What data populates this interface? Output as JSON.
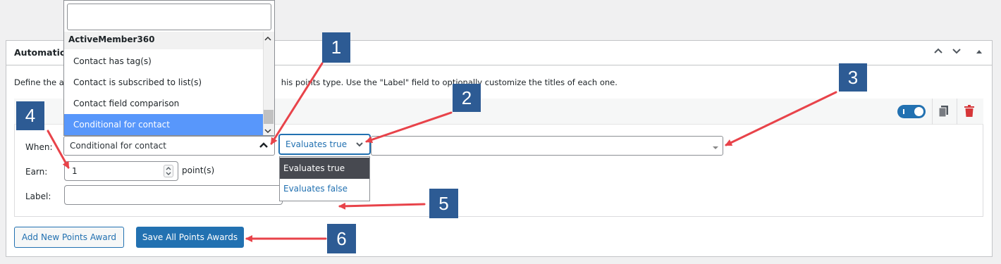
{
  "metabox": {
    "title": "Automatic",
    "description_left": "Define the a",
    "description_right": "his points type. Use the \"Label\" field to optionally customize the titles of each one.",
    "controls": {
      "up": "⌃",
      "down": "⌄",
      "toggle": "▲"
    }
  },
  "dropdown": {
    "search_value": "",
    "group": "ActiveMember360",
    "items": [
      "Contact has tag(s)",
      "Contact is subscribed to list(s)",
      "Contact field comparison",
      "Conditional for contact"
    ],
    "selected_index": 3
  },
  "award": {
    "when_label": "When:",
    "when_value": "Conditional for contact",
    "evaluates_value": "Evaluates true",
    "evaluates_options": [
      "Evaluates true",
      "Evaluates false"
    ],
    "earn_label": "Earn:",
    "earn_value": "1",
    "earn_unit": "point(s)",
    "label_label": "Label:",
    "label_value": "",
    "enabled": true
  },
  "buttons": {
    "add_new": "Add New Points Award",
    "save_all": "Save All Points Awards"
  },
  "callouts": [
    "1",
    "2",
    "3",
    "4",
    "5",
    "6"
  ],
  "colors": {
    "accent": "#2271b1",
    "callout": "#2d5b94",
    "arrow": "#e8434a",
    "delete": "#d63638",
    "selected": "#5897fb",
    "option_selected": "#474950"
  }
}
